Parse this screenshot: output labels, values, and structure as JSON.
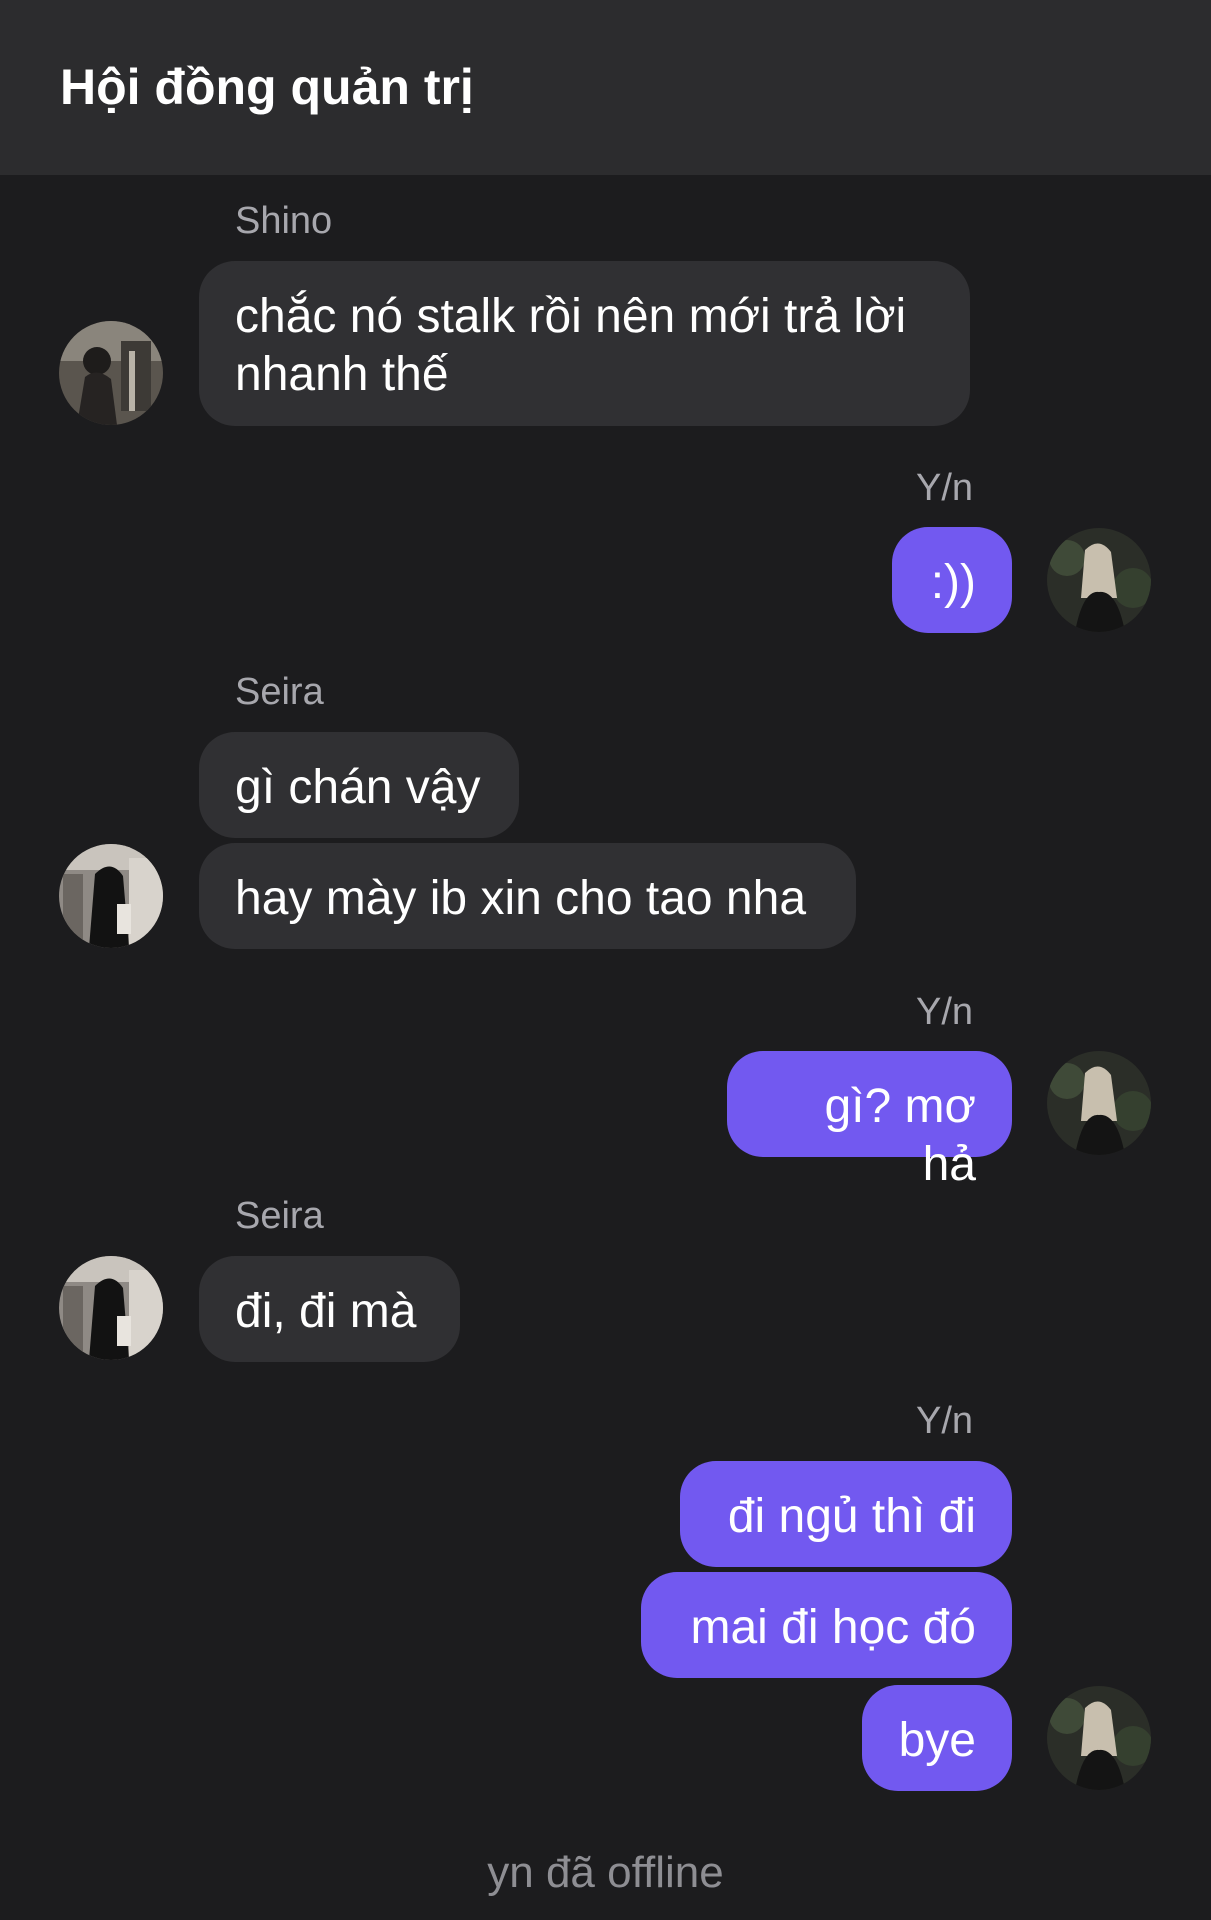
{
  "header": {
    "title": "Hội đồng quản trị"
  },
  "messages": [
    {
      "sender": "Shino",
      "texts": [
        "chắc nó stalk rồi nên mới trả lời nhanh thế"
      ]
    },
    {
      "sender": "Y/n",
      "texts": [
        ":))"
      ]
    },
    {
      "sender": "Seira",
      "texts": [
        "gì chán vậy",
        "hay mày ib xin cho tao nha"
      ]
    },
    {
      "sender": "Y/n",
      "texts": [
        "gì? mơ hả"
      ]
    },
    {
      "sender": "Seira",
      "texts": [
        "đi, đi mà"
      ]
    },
    {
      "sender": "Y/n",
      "texts": [
        "đi ngủ thì đi",
        "mai đi học đó",
        "bye"
      ]
    }
  ],
  "status": "yn đã offline",
  "colors": {
    "background": "#1c1c1e",
    "header": "#2c2c2e",
    "incoming_bubble": "#303033",
    "outgoing_bubble": "#7259f0",
    "sender_text": "#a7a7ad",
    "status_text": "#8e8e93"
  }
}
